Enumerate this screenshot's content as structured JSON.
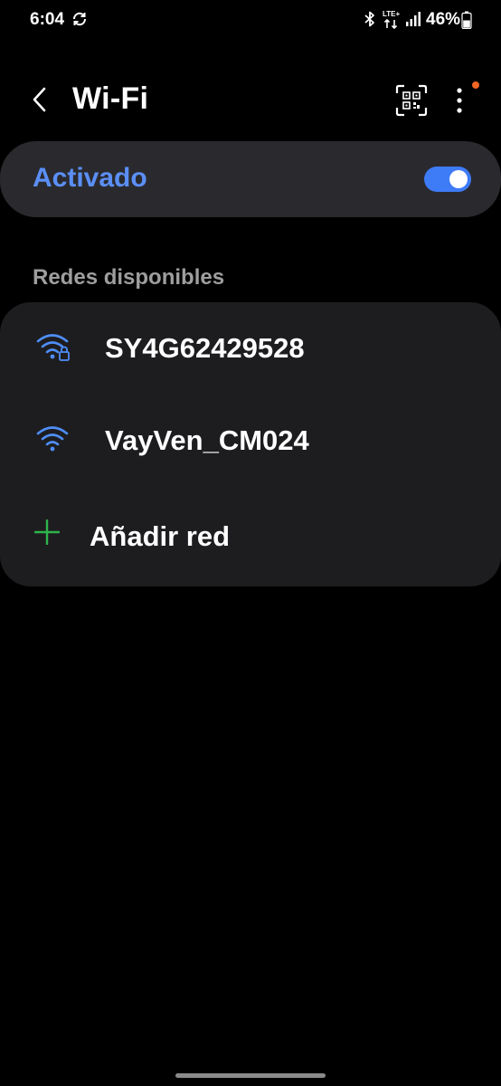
{
  "status_bar": {
    "time": "6:04",
    "network_type": "LTE+",
    "battery": "46%"
  },
  "header": {
    "title": "Wi-Fi"
  },
  "wifi_toggle": {
    "label": "Activado",
    "state": "on"
  },
  "available_networks": {
    "section_label": "Redes disponibles",
    "networks": [
      {
        "name": "SY4G62429528",
        "secured": true
      },
      {
        "name": "VayVen_CM024",
        "secured": false
      }
    ],
    "add_network_label": "Añadir red"
  },
  "colors": {
    "accent": "#5b8ff6",
    "switch_on": "#3e7bf7",
    "add_icon": "#2fb34a",
    "notification_dot": "#f26522"
  }
}
